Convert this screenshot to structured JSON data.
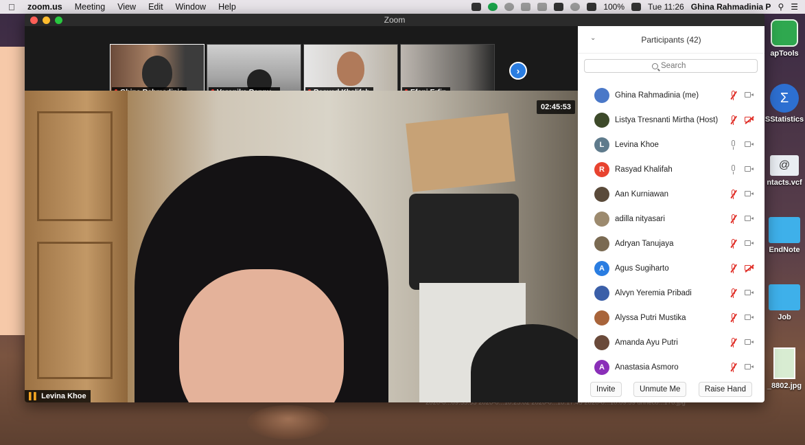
{
  "menubar": {
    "app_name": "zoom.us",
    "menus": [
      "Meeting",
      "View",
      "Edit",
      "Window",
      "Help"
    ],
    "battery": "100%",
    "clock": "Tue 11:26",
    "user": "Ghina Rahmadinia P"
  },
  "window": {
    "title": "Zoom",
    "thumbnails": [
      {
        "name": "Ghina Rahmadinia"
      },
      {
        "name": "Veronika Renny..."
      },
      {
        "name": "Rasyad Khalifah"
      },
      {
        "name": "Efani Erfin"
      }
    ],
    "timer": "02:45:53",
    "active_speaker": "Levina Khoe"
  },
  "participants": {
    "title": "Participants (42)",
    "search_placeholder": "Search",
    "list": [
      {
        "name": "Ghina Rahmadinia (me)",
        "initial": "",
        "avatar_color": "#4a78c8",
        "mic": "muted",
        "cam": "on"
      },
      {
        "name": "Listya Tresnanti Mirtha (Host)",
        "initial": "",
        "avatar_color": "#3d4a2a",
        "mic": "muted",
        "cam": "off"
      },
      {
        "name": "Levina Khoe",
        "initial": "L",
        "avatar_color": "#5f7b8c",
        "mic": "on",
        "cam": "on"
      },
      {
        "name": "Rasyad Khalifah",
        "initial": "R",
        "avatar_color": "#e8432f",
        "mic": "on",
        "cam": "on"
      },
      {
        "name": "Aan Kurniawan",
        "initial": "",
        "avatar_color": "#5a4a3a",
        "mic": "muted",
        "cam": "on"
      },
      {
        "name": "adilla nityasari",
        "initial": "",
        "avatar_color": "#9c8a6e",
        "mic": "muted",
        "cam": "on"
      },
      {
        "name": "Adryan Tanujaya",
        "initial": "",
        "avatar_color": "#7a6a52",
        "mic": "muted",
        "cam": "on"
      },
      {
        "name": "Agus Sugiharto",
        "initial": "A",
        "avatar_color": "#2a7de1",
        "mic": "muted",
        "cam": "off"
      },
      {
        "name": "Alvyn Yeremia Pribadi",
        "initial": "",
        "avatar_color": "#3b5fa8",
        "mic": "muted",
        "cam": "on"
      },
      {
        "name": "Alyssa Putri Mustika",
        "initial": "",
        "avatar_color": "#a8643a",
        "mic": "muted",
        "cam": "on"
      },
      {
        "name": "Amanda Ayu Putri",
        "initial": "",
        "avatar_color": "#6a4a3a",
        "mic": "muted",
        "cam": "on"
      },
      {
        "name": "Anastasia Asmoro",
        "initial": "A",
        "avatar_color": "#8a2fb8",
        "mic": "muted",
        "cam": "on"
      }
    ],
    "buttons": {
      "invite": "Invite",
      "unmute": "Unmute Me",
      "raise": "Raise Hand"
    }
  },
  "desktop": {
    "items": [
      {
        "label": "apTools",
        "icon": "app-icon"
      },
      {
        "label": "SStatistics",
        "icon": "sigma-icon"
      },
      {
        "label": "ntacts.vcf",
        "icon": "contact-card-icon"
      },
      {
        "label": "EndNote",
        "icon": "folder-icon"
      },
      {
        "label": "Job",
        "icon": "folder-icon"
      },
      {
        "label": "_8802.jpg",
        "icon": "image-file-icon"
      }
    ],
    "file_strip": "2020-0...09.55.55   2020-0...10.25.02   2020-0...10.17.45   2020-0...10.09.59   unneco...170.jpg"
  }
}
